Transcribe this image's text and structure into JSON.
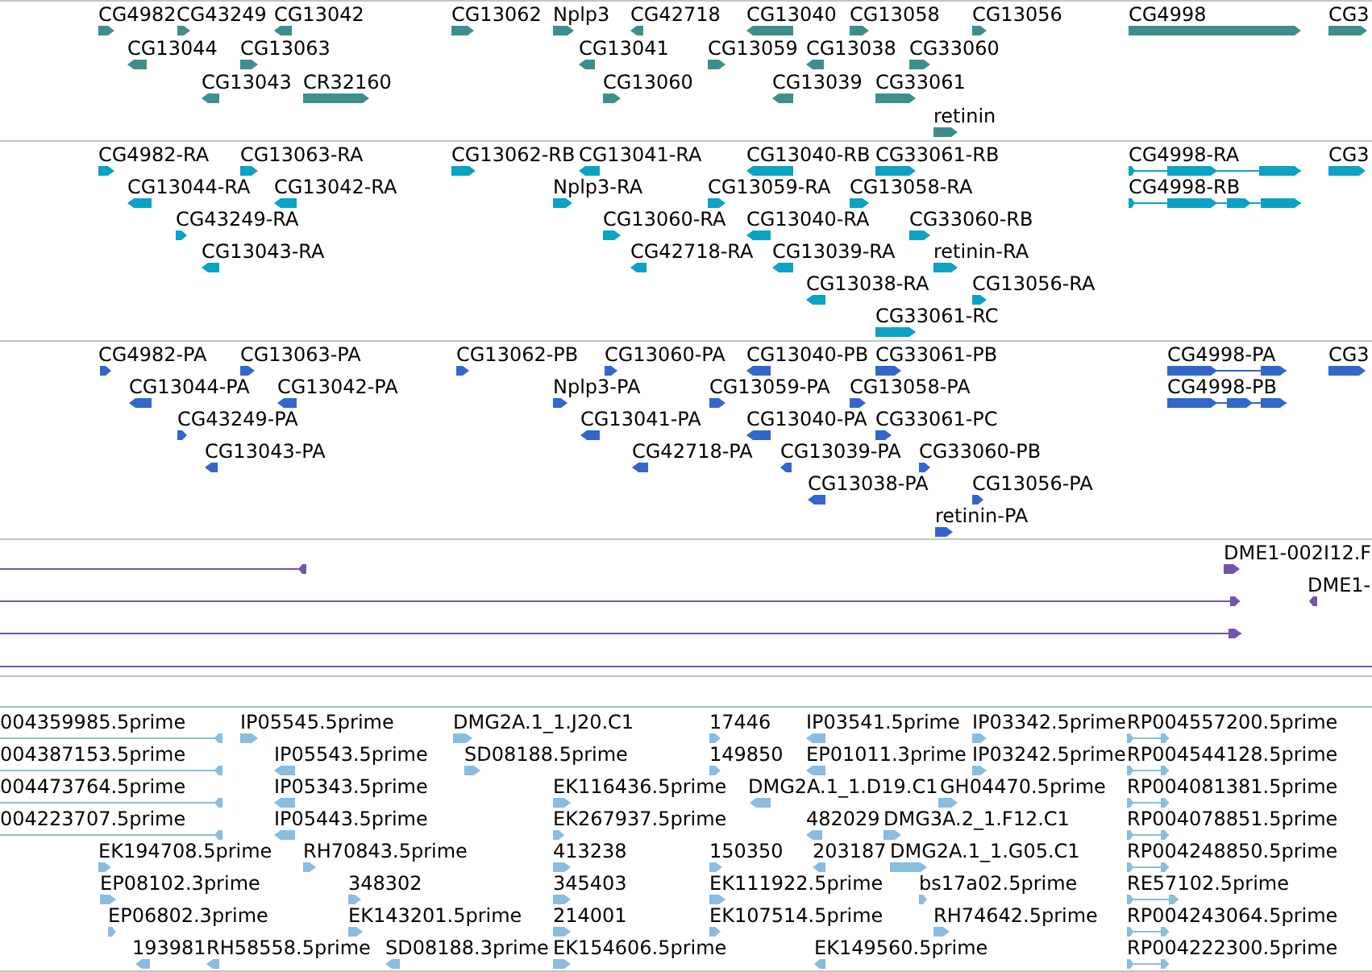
{
  "tracks": [
    {
      "kind": "gene",
      "features": [
        {
          "label": "CG4982",
          "kind": "block",
          "reverse": false
        },
        {
          "label": "CG43249",
          "kind": "block",
          "reverse": false
        },
        {
          "label": "CG13042",
          "kind": "block",
          "reverse": true
        },
        {
          "label": "CG13062",
          "kind": "block",
          "reverse": false
        },
        {
          "label": "Nplp3",
          "kind": "block",
          "reverse": false
        },
        {
          "label": "CG42718",
          "kind": "block",
          "reverse": true
        },
        {
          "label": "CG13040",
          "kind": "block",
          "reverse": true
        },
        {
          "label": "CG13058",
          "kind": "block",
          "reverse": false
        },
        {
          "label": "CG13056",
          "kind": "block",
          "reverse": false
        },
        {
          "label": "CG4998",
          "kind": "block",
          "reverse": false
        },
        {
          "label": "CG3",
          "kind": "block",
          "reverse": false
        },
        {
          "label": "CG13044",
          "kind": "block",
          "reverse": true
        },
        {
          "label": "CG13063",
          "kind": "block",
          "reverse": false
        },
        {
          "label": "CG13041",
          "kind": "block",
          "reverse": true
        },
        {
          "label": "CG13059",
          "kind": "block",
          "reverse": false
        },
        {
          "label": "CG13038",
          "kind": "block",
          "reverse": true
        },
        {
          "label": "CG33060",
          "kind": "block",
          "reverse": false
        },
        {
          "label": "CG13043",
          "kind": "block",
          "reverse": true
        },
        {
          "label": "CR32160",
          "kind": "block",
          "reverse": false
        },
        {
          "label": "CG13060",
          "kind": "block",
          "reverse": false
        },
        {
          "label": "CG13039",
          "kind": "block",
          "reverse": true
        },
        {
          "label": "CG33061",
          "kind": "block",
          "reverse": false
        },
        {
          "label": "retinin",
          "kind": "block",
          "reverse": false
        }
      ]
    },
    {
      "kind": "transcript",
      "features": [
        {
          "label": "CG4982-RA",
          "kind": "block",
          "reverse": false
        },
        {
          "label": "CG13063-RA",
          "kind": "block",
          "reverse": false
        },
        {
          "label": "CG13062-RB",
          "kind": "block",
          "reverse": false
        },
        {
          "label": "CG13041-RA",
          "kind": "block",
          "reverse": true
        },
        {
          "label": "CG13040-RB",
          "kind": "block",
          "reverse": true
        },
        {
          "label": "CG33061-RB",
          "kind": "block",
          "reverse": false
        },
        {
          "label": "CG4998-RA",
          "kind": "model",
          "reverse": false
        },
        {
          "label": "CG3",
          "kind": "block",
          "reverse": false
        },
        {
          "label": "CG13044-RA",
          "kind": "block",
          "reverse": true
        },
        {
          "label": "CG13042-RA",
          "kind": "block",
          "reverse": true
        },
        {
          "label": "Nplp3-RA",
          "kind": "block",
          "reverse": false
        },
        {
          "label": "CG13059-RA",
          "kind": "block",
          "reverse": false
        },
        {
          "label": "CG13058-RA",
          "kind": "block",
          "reverse": false
        },
        {
          "label": "CG4998-RB",
          "kind": "model",
          "reverse": false
        },
        {
          "label": "CG43249-RA",
          "kind": "block",
          "reverse": false
        },
        {
          "label": "CG13060-RA",
          "kind": "block",
          "reverse": false
        },
        {
          "label": "CG13040-RA",
          "kind": "block",
          "reverse": true
        },
        {
          "label": "CG33060-RB",
          "kind": "block",
          "reverse": false
        },
        {
          "label": "CG13043-RA",
          "kind": "block",
          "reverse": true
        },
        {
          "label": "CG42718-RA",
          "kind": "block",
          "reverse": true
        },
        {
          "label": "CG13039-RA",
          "kind": "block",
          "reverse": true
        },
        {
          "label": "retinin-RA",
          "kind": "block",
          "reverse": false
        },
        {
          "label": "CG13038-RA",
          "kind": "block",
          "reverse": true
        },
        {
          "label": "CG13056-RA",
          "kind": "block",
          "reverse": false
        },
        {
          "label": "CG33061-RC",
          "kind": "block",
          "reverse": false
        }
      ]
    },
    {
      "kind": "protein",
      "features": [
        {
          "label": "CG4982-PA",
          "kind": "block",
          "reverse": false
        },
        {
          "label": "CG13063-PA",
          "kind": "block",
          "reverse": false
        },
        {
          "label": "CG13062-PB",
          "kind": "block",
          "reverse": false
        },
        {
          "label": "CG13060-PA",
          "kind": "block",
          "reverse": false
        },
        {
          "label": "CG13040-PB",
          "kind": "block",
          "reverse": true
        },
        {
          "label": "CG33061-PB",
          "kind": "block",
          "reverse": false
        },
        {
          "label": "CG4998-PA",
          "kind": "model",
          "reverse": false
        },
        {
          "label": "CG3",
          "kind": "block",
          "reverse": false
        },
        {
          "label": "CG13044-PA",
          "kind": "block",
          "reverse": true
        },
        {
          "label": "CG13042-PA",
          "kind": "block",
          "reverse": true
        },
        {
          "label": "Nplp3-PA",
          "kind": "block",
          "reverse": false
        },
        {
          "label": "CG13059-PA",
          "kind": "block",
          "reverse": false
        },
        {
          "label": "CG13058-PA",
          "kind": "block",
          "reverse": false
        },
        {
          "label": "CG4998-PB",
          "kind": "model",
          "reverse": false
        },
        {
          "label": "CG43249-PA",
          "kind": "block",
          "reverse": false
        },
        {
          "label": "CG13041-PA",
          "kind": "block",
          "reverse": true
        },
        {
          "label": "CG13040-PA",
          "kind": "block",
          "reverse": true
        },
        {
          "label": "CG33061-PC",
          "kind": "block",
          "reverse": false
        },
        {
          "label": "CG13043-PA",
          "kind": "block",
          "reverse": true
        },
        {
          "label": "CG42718-PA",
          "kind": "block",
          "reverse": true
        },
        {
          "label": "CG13039-PA",
          "kind": "block",
          "reverse": true
        },
        {
          "label": "CG33060-PB",
          "kind": "block",
          "reverse": false
        },
        {
          "label": "CG13038-PA",
          "kind": "block",
          "reverse": true
        },
        {
          "label": "CG13056-PA",
          "kind": "block",
          "reverse": false
        },
        {
          "label": "retinin-PA",
          "kind": "block",
          "reverse": false
        }
      ]
    },
    {
      "kind": "clone",
      "features": [
        {
          "kind": "model",
          "reverse": true
        },
        {
          "label": "DME1-002I12.F",
          "kind": "block",
          "reverse": false
        },
        {
          "kind": "model",
          "reverse": false
        },
        {
          "label": "DME1-",
          "kind": "block",
          "reverse": true
        },
        {
          "kind": "model",
          "reverse": false
        },
        {
          "kind": "line"
        }
      ]
    },
    {
      "kind": "est",
      "features": [
        {
          "kind": "line"
        },
        {
          "label": "004359985.5prime",
          "kind": "model",
          "reverse": true
        },
        {
          "label": "IP05545.5prime",
          "kind": "block",
          "reverse": false
        },
        {
          "label": "DMG2A.1_1.J20.C1",
          "kind": "block",
          "reverse": false
        },
        {
          "label": "17446",
          "kind": "block",
          "reverse": false
        },
        {
          "label": "IP03541.5prime",
          "kind": "block",
          "reverse": true
        },
        {
          "label": "IP03342.5prime",
          "kind": "block",
          "reverse": false
        },
        {
          "label": "RP004557200.5prime",
          "kind": "model",
          "reverse": false
        },
        {
          "label": "004387153.5prime",
          "kind": "model",
          "reverse": true
        },
        {
          "label": "IP05543.5prime",
          "kind": "block",
          "reverse": true
        },
        {
          "label": "SD08188.5prime",
          "kind": "block",
          "reverse": false
        },
        {
          "label": "149850",
          "kind": "block",
          "reverse": false
        },
        {
          "label": "EP01011.3prime",
          "kind": "block",
          "reverse": true
        },
        {
          "label": "IP03242.5prime",
          "kind": "block",
          "reverse": false
        },
        {
          "label": "RP004544128.5prime",
          "kind": "model",
          "reverse": false
        },
        {
          "label": "004473764.5prime",
          "kind": "model",
          "reverse": true
        },
        {
          "label": "IP05343.5prime",
          "kind": "block",
          "reverse": true
        },
        {
          "label": "EK116436.5prime",
          "kind": "block",
          "reverse": false
        },
        {
          "label": "DMG2A.1_1.D19.C1",
          "kind": "block",
          "reverse": true
        },
        {
          "label": "GH04470.5prime",
          "kind": "block",
          "reverse": false
        },
        {
          "label": "RP004081381.5prime",
          "kind": "model",
          "reverse": false
        },
        {
          "label": "004223707.5prime",
          "kind": "model",
          "reverse": true
        },
        {
          "label": "IP05443.5prime",
          "kind": "block",
          "reverse": true
        },
        {
          "label": "EK267937.5prime",
          "kind": "block",
          "reverse": false
        },
        {
          "label": "482029",
          "kind": "block",
          "reverse": true
        },
        {
          "label": "DMG3A.2_1.F12.C1",
          "kind": "block",
          "reverse": false
        },
        {
          "label": "RP004078851.5prime",
          "kind": "model",
          "reverse": false
        },
        {
          "label": "EK194708.5prime",
          "kind": "block",
          "reverse": false
        },
        {
          "label": "RH70843.5prime",
          "kind": "block",
          "reverse": false
        },
        {
          "label": "413238",
          "kind": "block",
          "reverse": false
        },
        {
          "label": "150350",
          "kind": "block",
          "reverse": false
        },
        {
          "label": "203187",
          "kind": "block",
          "reverse": true
        },
        {
          "label": "DMG2A.1_1.G05.C1",
          "kind": "block",
          "reverse": false
        },
        {
          "label": "RP004248850.5prime",
          "kind": "model",
          "reverse": false
        },
        {
          "label": "EP08102.3prime",
          "kind": "block",
          "reverse": false
        },
        {
          "label": "348302",
          "kind": "block",
          "reverse": false
        },
        {
          "label": "345403",
          "kind": "block",
          "reverse": false
        },
        {
          "label": "EK111922.5prime",
          "kind": "block",
          "reverse": false
        },
        {
          "label": "bs17a02.5prime",
          "kind": "block",
          "reverse": false
        },
        {
          "label": "RE57102.5prime",
          "kind": "model",
          "reverse": false
        },
        {
          "label": "EP06802.3prime",
          "kind": "block",
          "reverse": false
        },
        {
          "label": "EK143201.5prime",
          "kind": "block",
          "reverse": false
        },
        {
          "label": "214001",
          "kind": "block",
          "reverse": false
        },
        {
          "label": "EK107514.5prime",
          "kind": "block",
          "reverse": false
        },
        {
          "label": "RH74642.5prime",
          "kind": "block",
          "reverse": false
        },
        {
          "label": "RP004243064.5prime",
          "kind": "model",
          "reverse": false
        },
        {
          "label": "193981",
          "kind": "block",
          "reverse": true
        },
        {
          "label": "RH58558.5prime",
          "kind": "block",
          "reverse": true
        },
        {
          "label": "SD08188.3prime",
          "kind": "block",
          "reverse": true
        },
        {
          "label": "EK154606.5prime",
          "kind": "block",
          "reverse": false
        },
        {
          "label": "EK149560.5prime",
          "kind": "block",
          "reverse": true
        },
        {
          "label": "RP004222300.5prime",
          "kind": "model",
          "reverse": false
        }
      ]
    }
  ]
}
